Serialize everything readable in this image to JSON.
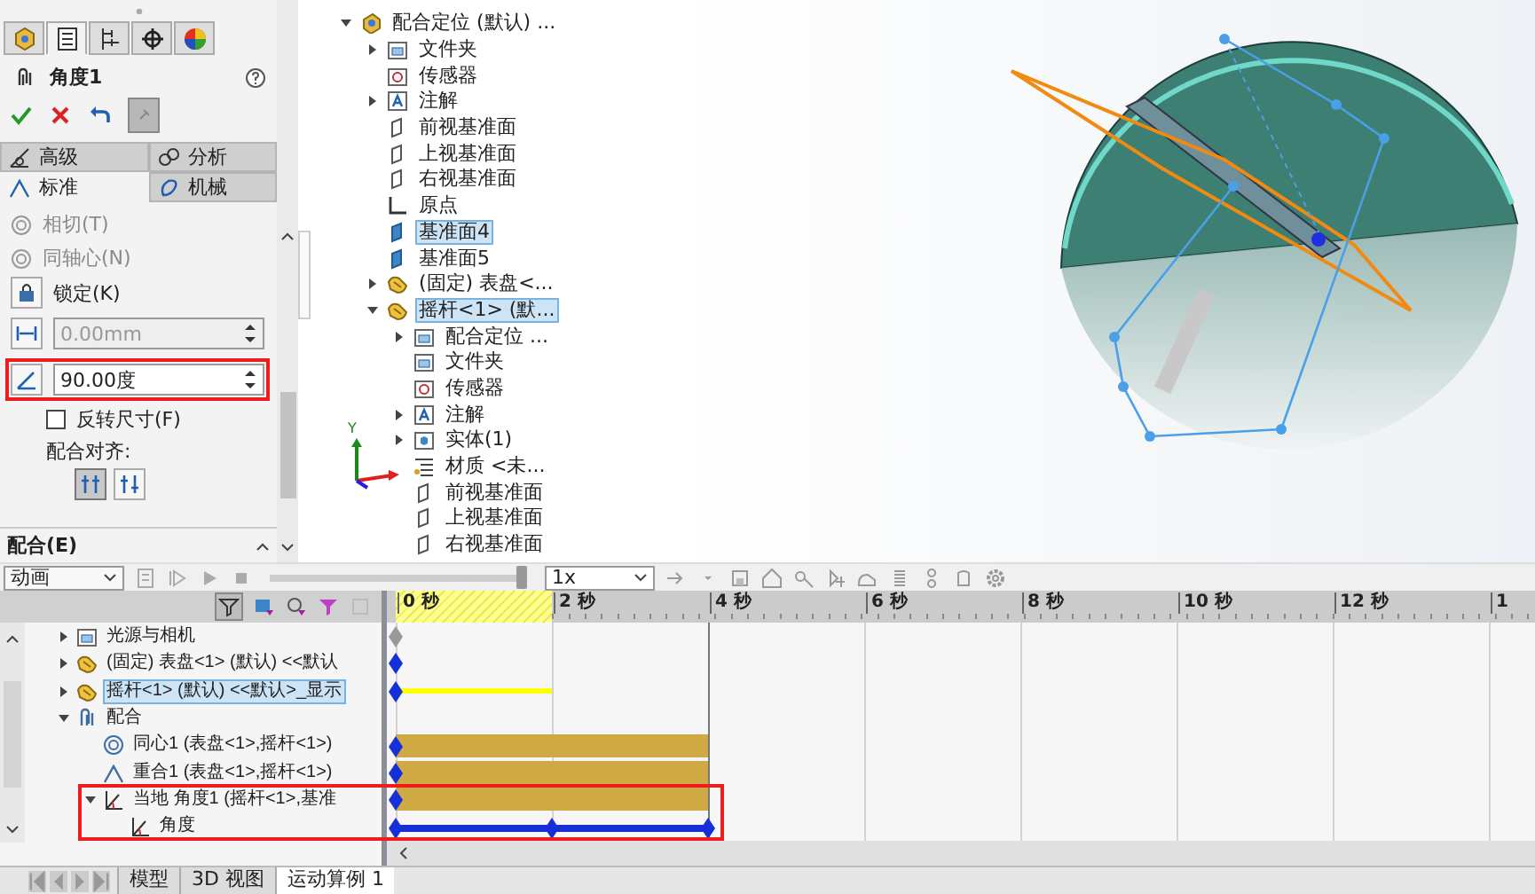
{
  "property_manager": {
    "tabs": [
      {
        "kind": "feature",
        "selected": false
      },
      {
        "kind": "property",
        "selected": true
      },
      {
        "kind": "config",
        "selected": false
      },
      {
        "kind": "target",
        "selected": false
      },
      {
        "kind": "display",
        "selected": false
      }
    ],
    "title": "角度1",
    "section_tabs": [
      {
        "label": "高级",
        "kind": "advanced",
        "selected": false
      },
      {
        "label": "分析",
        "kind": "analysis",
        "selected": false
      },
      {
        "label": "标准",
        "kind": "standard",
        "selected": true
      },
      {
        "label": "机械",
        "kind": "mechanical",
        "selected": false
      }
    ],
    "options": [
      {
        "kind": "radio",
        "label": "相切(T)",
        "disabled": true
      },
      {
        "kind": "radio",
        "label": "同轴心(N)",
        "disabled": true
      },
      {
        "kind": "lock",
        "label": "锁定(K)",
        "disabled": false
      },
      {
        "kind": "distance",
        "value": "0.00mm",
        "disabled": true,
        "highlighted": false
      },
      {
        "kind": "angle",
        "value": "90.00度",
        "disabled": false,
        "highlighted": true
      },
      {
        "kind": "checkbox",
        "label": "反转尺寸(F)",
        "checked": false
      },
      {
        "kind": "label",
        "label": "配合对齐:"
      },
      {
        "kind": "align",
        "buttons": [
          {
            "selected": true
          },
          {
            "selected": false
          }
        ]
      }
    ],
    "section": {
      "label": "配合(E)",
      "expanded": true
    }
  },
  "feature_tree": [
    {
      "label": "配合定位 (默认) ...",
      "kind": "assembly",
      "expanded": true,
      "selected": false,
      "children": [
        {
          "label": "文件夹",
          "kind": "folder",
          "expanded": false,
          "selected": false
        },
        {
          "label": "传感器",
          "kind": "sensor",
          "selected": false
        },
        {
          "label": "注解",
          "kind": "annotation",
          "expanded": false,
          "selected": false
        },
        {
          "label": "前视基准面",
          "kind": "plane",
          "selected": false
        },
        {
          "label": "上视基准面",
          "kind": "plane",
          "selected": false
        },
        {
          "label": "右视基准面",
          "kind": "plane",
          "selected": false
        },
        {
          "label": "原点",
          "kind": "origin",
          "selected": false
        },
        {
          "label": "基准面4",
          "kind": "plane-solid",
          "selected": true
        },
        {
          "label": "基准面5",
          "kind": "plane-solid",
          "selected": false
        },
        {
          "label": "(固定) 表盘<...",
          "kind": "part",
          "expanded": false,
          "selected": false
        },
        {
          "label": "摇杆<1> (默...",
          "kind": "part",
          "expanded": true,
          "selected": true,
          "children": [
            {
              "label": "配合定位 ...",
              "kind": "folder",
              "expanded": false,
              "selected": false
            },
            {
              "label": "文件夹",
              "kind": "folder",
              "selected": false
            },
            {
              "label": "传感器",
              "kind": "sensor",
              "selected": false
            },
            {
              "label": "注解",
              "kind": "annotation",
              "expanded": false,
              "selected": false
            },
            {
              "label": "实体(1)",
              "kind": "body",
              "expanded": false,
              "selected": false
            },
            {
              "label": "材质 <未...",
              "kind": "material",
              "selected": false
            },
            {
              "label": "前视基准面",
              "kind": "plane",
              "selected": false
            },
            {
              "label": "上视基准面",
              "kind": "plane",
              "selected": false
            },
            {
              "label": "右视基准面",
              "kind": "plane",
              "selected": false
            }
          ]
        }
      ]
    }
  ],
  "triad_label": "Y",
  "motion_toolbar": {
    "study_type": "动画",
    "playback_speed": "1x",
    "slider": {
      "level": 0.98
    }
  },
  "timeline": {
    "ticks": [
      "0 秒",
      "2 秒",
      "4 秒",
      "6 秒",
      "8 秒",
      "10 秒",
      "12 秒",
      "1"
    ]
  },
  "motion_tree": [
    {
      "label": "光源与相机",
      "kind": "lights",
      "expanded": false,
      "selected": false,
      "highlighted": false
    },
    {
      "label": "(固定) 表盘<1> (默认) <<默认",
      "kind": "fixed-part",
      "expanded": false,
      "selected": false,
      "highlighted": false
    },
    {
      "label": "摇杆<1> (默认) <<默认>_显示",
      "kind": "moving-part",
      "expanded": false,
      "selected": true,
      "highlighted": false
    },
    {
      "label": "配合",
      "kind": "mate-folder",
      "expanded": true,
      "selected": false,
      "highlighted": false,
      "children": [
        {
          "label": "同心1 (表盘<1>,摇杆<1>)",
          "kind": "concentric-mate",
          "selected": false,
          "highlighted": false
        },
        {
          "label": "重合1 (表盘<1>,摇杆<1>)",
          "kind": "coincident-mate",
          "selected": false,
          "highlighted": false
        },
        {
          "label": "当地 角度1 (摇杆<1>,基准",
          "kind": "angle-mate",
          "expanded": true,
          "selected": false,
          "highlighted": true,
          "children": [
            {
              "label": "角度",
              "kind": "angle-driver",
              "selected": false,
              "highlighted": true
            }
          ]
        }
      ]
    }
  ],
  "bottom_tabs": [
    {
      "label": "模型",
      "selected": false
    },
    {
      "label": "3D 视图",
      "selected": false
    },
    {
      "label": "运动算例 1",
      "selected": true
    }
  ]
}
